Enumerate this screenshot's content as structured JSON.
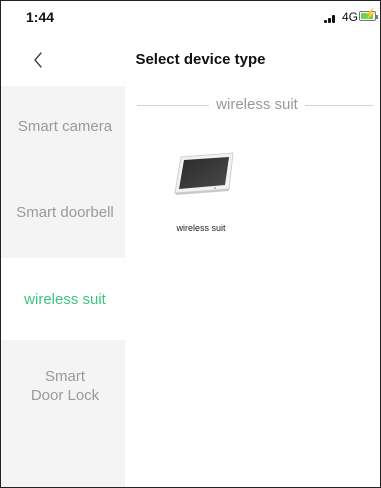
{
  "status_bar": {
    "time": "1:44",
    "network": "4G"
  },
  "header": {
    "title": "Select device type"
  },
  "sidebar": {
    "items": [
      {
        "label": "Smart camera",
        "selected": false
      },
      {
        "label": "Smart doorbell",
        "selected": false
      },
      {
        "label": "wireless suit",
        "selected": true
      },
      {
        "label": "Smart Door Lock",
        "selected": false
      }
    ]
  },
  "main": {
    "section_title": "wireless suit",
    "devices": [
      {
        "label": "wireless suit",
        "icon": "tablet-monitor-icon"
      }
    ]
  },
  "colors": {
    "accent": "#3cc483",
    "sidebar_bg": "#f4f4f4",
    "inactive_text": "#9a9a9a"
  }
}
